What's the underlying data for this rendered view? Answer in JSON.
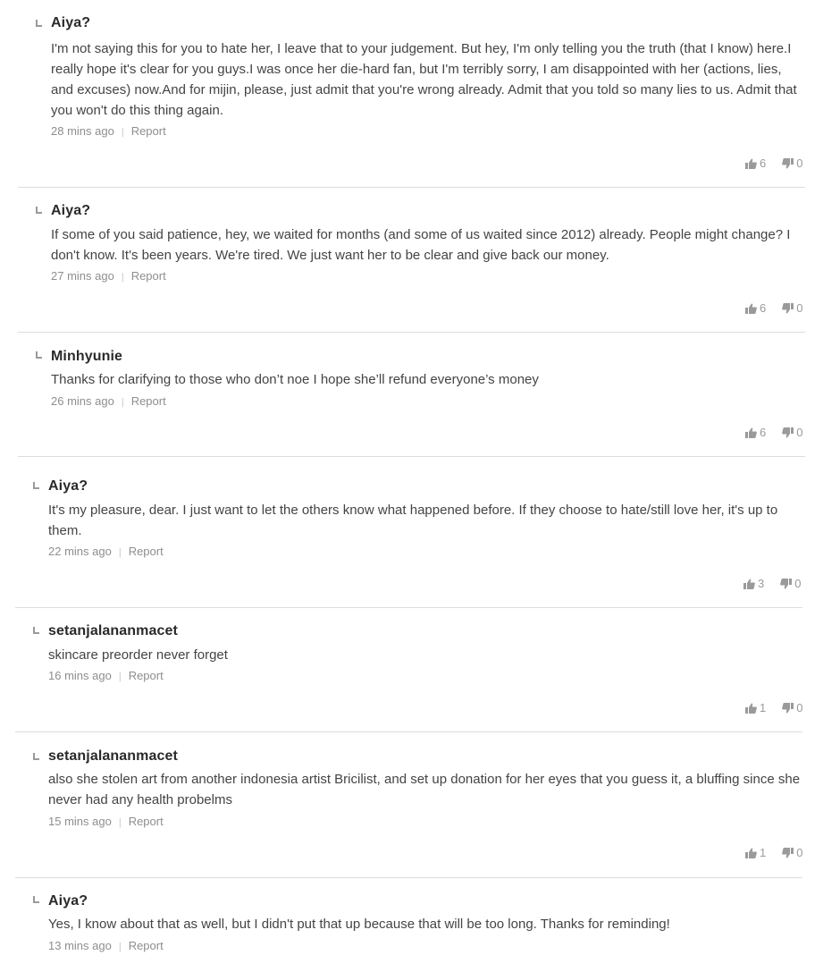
{
  "report_label": "Report",
  "comments": [
    {
      "author": "Aiya?",
      "text": "I'm not saying this for you to hate her, I leave that to your judgement. But hey, I'm only telling you the truth (that I know) here.I really hope it's clear for you guys.I was once her die-hard fan, but I'm terribly sorry, I am disappointed with her (actions, lies, and excuses) now.And for mijin, please, just admit that you're wrong already. Admit that you told so many lies to us. Admit that you won't do this thing again.",
      "time": "28 mins ago",
      "likes": "6",
      "dislikes": "0"
    },
    {
      "author": "Aiya?",
      "text": "If some of you said patience, hey, we waited for months (and some of us waited since 2012) already. People might change? I don't know. It's been years. We're tired. We just want her to be clear and give back our money.",
      "time": "27 mins ago",
      "likes": "6",
      "dislikes": "0"
    },
    {
      "author": "Minhyunie",
      "text": "Thanks for clarifying to those who don’t noe I hope she’ll refund everyone’s money",
      "time": "26 mins ago",
      "likes": "6",
      "dislikes": "0"
    },
    {
      "author": "Aiya?",
      "text": "It's my pleasure, dear. I just want to let the others know what happened before. If they choose to hate/still love her, it's up to them.",
      "time": "22 mins ago",
      "likes": "3",
      "dislikes": "0"
    },
    {
      "author": "setanjalananmacet",
      "text": "skincare preorder never forget",
      "time": "16 mins ago",
      "likes": "1",
      "dislikes": "0"
    },
    {
      "author": "setanjalananmacet",
      "text": "also she stolen art from another indonesia artist Bricilist, and set up donation for her eyes that you guess it, a bluffing since she never had any health probelms",
      "time": "15 mins ago",
      "likes": "1",
      "dislikes": "0"
    },
    {
      "author": "Aiya?",
      "text": "Yes, I know about that as well, but I didn't put that up because that will be too long. Thanks for reminding!",
      "time": "13 mins ago",
      "likes": "",
      "dislikes": ""
    }
  ]
}
